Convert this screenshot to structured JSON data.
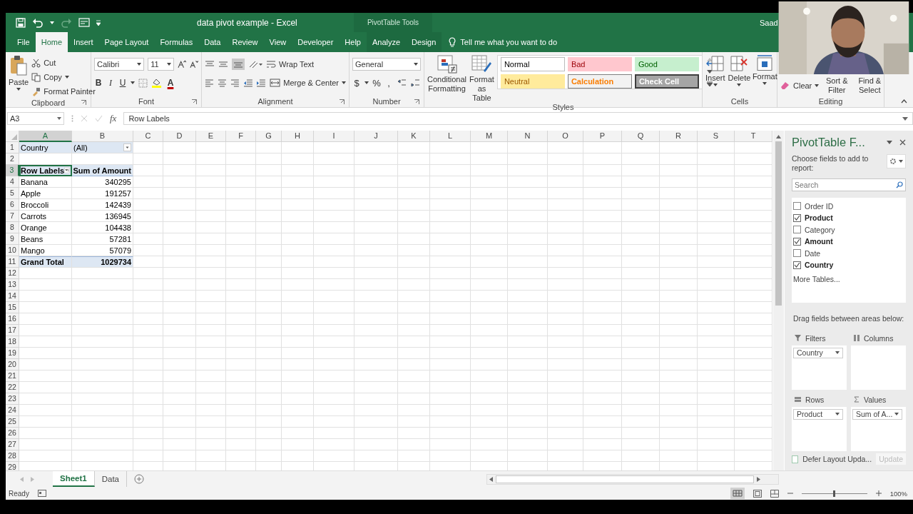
{
  "window": {
    "title": "data pivot example  -  Excel",
    "context_title": "PivotTable Tools",
    "user": "Saad"
  },
  "tabs": [
    {
      "label": "File",
      "selected": false,
      "kind": "normal"
    },
    {
      "label": "Home",
      "selected": true,
      "kind": "normal"
    },
    {
      "label": "Insert",
      "selected": false,
      "kind": "normal"
    },
    {
      "label": "Page Layout",
      "selected": false,
      "kind": "normal"
    },
    {
      "label": "Formulas",
      "selected": false,
      "kind": "normal"
    },
    {
      "label": "Data",
      "selected": false,
      "kind": "normal"
    },
    {
      "label": "Review",
      "selected": false,
      "kind": "normal"
    },
    {
      "label": "View",
      "selected": false,
      "kind": "normal"
    },
    {
      "label": "Developer",
      "selected": false,
      "kind": "normal"
    },
    {
      "label": "Help",
      "selected": false,
      "kind": "normal"
    },
    {
      "label": "Analyze",
      "selected": false,
      "kind": "contextual"
    },
    {
      "label": "Design",
      "selected": false,
      "kind": "contextual"
    }
  ],
  "tell_me": {
    "placeholder": "Tell me what you want to do"
  },
  "ribbon": {
    "clipboard": {
      "label": "Clipboard",
      "paste": "Paste",
      "cut": "Cut",
      "copy": "Copy",
      "format_painter": "Format Painter"
    },
    "font": {
      "label": "Font",
      "name": "Calibri",
      "size": "11",
      "bold": "B",
      "italic": "I",
      "underline": "U",
      "font_color": "A"
    },
    "alignment": {
      "label": "Alignment",
      "wrap": "Wrap Text",
      "merge": "Merge & Center"
    },
    "number": {
      "label": "Number",
      "format": "General",
      "currency": "$",
      "percent": "%",
      "comma": ","
    },
    "styles": {
      "label": "Styles",
      "conditional": "Conditional Formatting",
      "format_table": "Format as Table",
      "cells": [
        {
          "label": "Normal",
          "kind": "normal"
        },
        {
          "label": "Bad",
          "kind": "bad"
        },
        {
          "label": "Good",
          "kind": "good"
        },
        {
          "label": "Neutral",
          "kind": "neutral"
        },
        {
          "label": "Calculation",
          "kind": "calculation"
        },
        {
          "label": "Check Cell",
          "kind": "check"
        }
      ]
    },
    "cells": {
      "label": "Cells",
      "buttons": [
        "Insert",
        "Delete",
        "Format"
      ]
    },
    "editing": {
      "label": "Editing",
      "clear": "Clear",
      "sort": "Sort & Filter",
      "find": "Find & Select"
    }
  },
  "formula_bar": {
    "name_box": "A3",
    "function_label": "fx",
    "value": "Row Labels"
  },
  "columns": [
    {
      "label": "A",
      "selected": true
    },
    {
      "label": "B",
      "selected": false
    },
    {
      "label": "C",
      "selected": false
    },
    {
      "label": "D",
      "selected": false
    },
    {
      "label": "E",
      "selected": false
    },
    {
      "label": "F",
      "selected": false
    },
    {
      "label": "G",
      "selected": false
    },
    {
      "label": "H",
      "selected": false
    },
    {
      "label": "I",
      "selected": false
    },
    {
      "label": "J",
      "selected": false
    },
    {
      "label": "K",
      "selected": false
    },
    {
      "label": "L",
      "selected": false
    },
    {
      "label": "M",
      "selected": false
    },
    {
      "label": "N",
      "selected": false
    },
    {
      "label": "O",
      "selected": false
    },
    {
      "label": "P",
      "selected": false
    },
    {
      "label": "Q",
      "selected": false
    },
    {
      "label": "R",
      "selected": false
    },
    {
      "label": "S",
      "selected": false
    },
    {
      "label": "T",
      "selected": false
    }
  ],
  "row_numbers": [
    {
      "label": "1",
      "selected": false
    },
    {
      "label": "2",
      "selected": false
    },
    {
      "label": "3",
      "selected": true
    },
    {
      "label": "4",
      "selected": false
    },
    {
      "label": "5",
      "selected": false
    },
    {
      "label": "6",
      "selected": false
    },
    {
      "label": "7",
      "selected": false
    },
    {
      "label": "8",
      "selected": false
    },
    {
      "label": "9",
      "selected": false
    },
    {
      "label": "10",
      "selected": false
    },
    {
      "label": "11",
      "selected": false
    },
    {
      "label": "12",
      "selected": false
    },
    {
      "label": "13",
      "selected": false
    },
    {
      "label": "14",
      "selected": false
    },
    {
      "label": "15",
      "selected": false
    },
    {
      "label": "16",
      "selected": false
    },
    {
      "label": "17",
      "selected": false
    },
    {
      "label": "18",
      "selected": false
    },
    {
      "label": "19",
      "selected": false
    },
    {
      "label": "20",
      "selected": false
    },
    {
      "label": "21",
      "selected": false
    },
    {
      "label": "22",
      "selected": false
    },
    {
      "label": "23",
      "selected": false
    },
    {
      "label": "24",
      "selected": false
    },
    {
      "label": "25",
      "selected": false
    },
    {
      "label": "26",
      "selected": false
    },
    {
      "label": "27",
      "selected": false
    },
    {
      "label": "28",
      "selected": false
    },
    {
      "label": "29",
      "selected": false
    }
  ],
  "pivot": {
    "filter": {
      "field": "Country",
      "value": "(All)"
    },
    "header": [
      "Row Labels",
      "Sum of Amount"
    ],
    "rows": [
      {
        "label": "Banana",
        "value": "340295"
      },
      {
        "label": "Apple",
        "value": "191257"
      },
      {
        "label": "Broccoli",
        "value": "142439"
      },
      {
        "label": "Carrots",
        "value": "136945"
      },
      {
        "label": "Orange",
        "value": "104438"
      },
      {
        "label": "Beans",
        "value": "57281"
      },
      {
        "label": "Mango",
        "value": "57079"
      }
    ],
    "total": {
      "label": "Grand Total",
      "value": "1029734"
    }
  },
  "field_pane": {
    "title": "PivotTable F...",
    "prompt": "Choose fields to add to report:",
    "search": {
      "placeholder": "Search"
    },
    "fields": [
      {
        "label": "Order ID",
        "checked": false
      },
      {
        "label": "Product",
        "checked": true
      },
      {
        "label": "Category",
        "checked": false
      },
      {
        "label": "Amount",
        "checked": true
      },
      {
        "label": "Date",
        "checked": false
      },
      {
        "label": "Country",
        "checked": true
      }
    ],
    "more_tables": "More Tables...",
    "drag_hint": "Drag fields between areas below:",
    "areas": [
      {
        "kind": "filters",
        "title": "Filters",
        "items": [
          "Country"
        ]
      },
      {
        "kind": "columns",
        "title": "Columns"
      },
      {
        "kind": "rows",
        "title": "Rows",
        "items": [
          "Product"
        ]
      },
      {
        "kind": "values",
        "title": "Values",
        "items": [
          "Sum of A..."
        ]
      }
    ],
    "defer": {
      "label": "Defer Layout Upda...",
      "checked": false
    },
    "update": {
      "label": "Update",
      "disabled": true
    }
  },
  "sheet_tabs": [
    {
      "label": "Sheet1",
      "selected": true
    },
    {
      "label": "Data",
      "selected": false
    }
  ],
  "status_bar": {
    "text": "Ready",
    "zoom": "100%",
    "zoom_slider": {
      "level": 0.5
    }
  }
}
